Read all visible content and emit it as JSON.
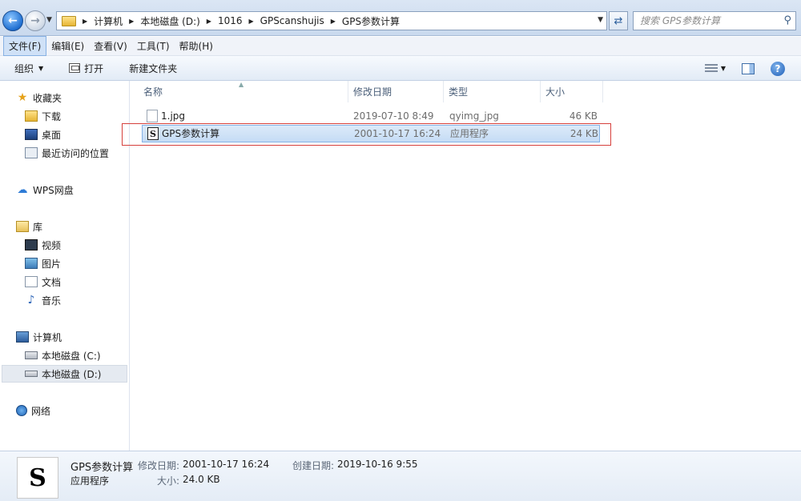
{
  "address": {
    "crumbs": [
      "计算机",
      "本地磁盘 (D:)",
      "1016",
      "GPScanshujis",
      "GPS参数计算"
    ],
    "search_placeholder": "搜索 GPS参数计算"
  },
  "menu": [
    "文件(F)",
    "编辑(E)",
    "查看(V)",
    "工具(T)",
    "帮助(H)"
  ],
  "toolbar": {
    "organize": "组织",
    "open": "打开",
    "new_folder": "新建文件夹"
  },
  "sidebar": {
    "favorites": "收藏夹",
    "downloads": "下载",
    "desktop": "桌面",
    "recent": "最近访问的位置",
    "wps": "WPS网盘",
    "libraries": "库",
    "videos": "视频",
    "pictures": "图片",
    "documents": "文档",
    "music": "音乐",
    "computer": "计算机",
    "drive_c": "本地磁盘 (C:)",
    "drive_d": "本地磁盘 (D:)",
    "network": "网络"
  },
  "columns": {
    "name": "名称",
    "date": "修改日期",
    "type": "类型",
    "size": "大小"
  },
  "files": [
    {
      "name": "1.jpg",
      "date": "2019-07-10 8:49",
      "type": "qyimg_jpg",
      "size": "46 KB",
      "icon": "jpg-file-icon",
      "selected": false
    },
    {
      "name": "GPS参数计算",
      "date": "2001-10-17 16:24",
      "type": "应用程序",
      "size": "24 KB",
      "icon": "exe-file-icon",
      "selected": true
    }
  ],
  "details": {
    "name": "GPS参数计算",
    "type": "应用程序",
    "modified_label": "修改日期:",
    "modified": "2001-10-17 16:24",
    "created_label": "创建日期:",
    "created": "2019-10-16 9:55",
    "size_label": "大小:",
    "size": "24.0 KB"
  },
  "colors": {
    "highlight_box": "#d6403c",
    "selection": "#c5dcf5"
  }
}
